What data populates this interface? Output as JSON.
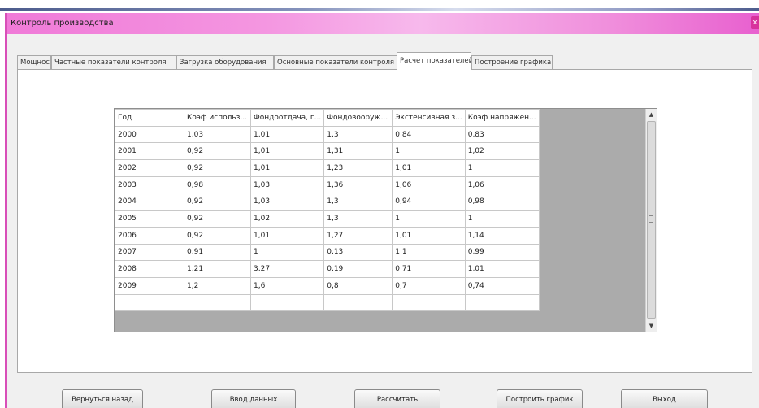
{
  "window": {
    "title": "Контроль производства",
    "close_label": "x"
  },
  "tabs": [
    {
      "label": "Мощность",
      "active": false
    },
    {
      "label": "Частные показатели контроля",
      "active": false
    },
    {
      "label": "Загрузка оборудования",
      "active": false
    },
    {
      "label": "Основные показатели контроля",
      "active": false
    },
    {
      "label": "Расчет показателей",
      "active": true
    },
    {
      "label": "Построение графика",
      "active": false
    }
  ],
  "grid": {
    "columns": [
      "Год",
      "Коэф использ...",
      "Фондоотдача, г...",
      "Фондовооруж...",
      "Экстенсивная з...",
      "Коэф напряжен..."
    ],
    "rows": [
      [
        "2000",
        "1,03",
        "1,01",
        "1,3",
        "0,84",
        "0,83"
      ],
      [
        "2001",
        "0,92",
        "1,01",
        "1,31",
        "1",
        "1,02"
      ],
      [
        "2002",
        "0,92",
        "1,01",
        "1,23",
        "1,01",
        "1"
      ],
      [
        "2003",
        "0,98",
        "1,03",
        "1,36",
        "1,06",
        "1,06"
      ],
      [
        "2004",
        "0,92",
        "1,03",
        "1,3",
        "0,94",
        "0,98"
      ],
      [
        "2005",
        "0,92",
        "1,02",
        "1,3",
        "1",
        "1"
      ],
      [
        "2006",
        "0,92",
        "1,01",
        "1,27",
        "1,01",
        "1,14"
      ],
      [
        "2007",
        "0,91",
        "1",
        "0,13",
        "1,1",
        "0,99"
      ],
      [
        "2008",
        "1,21",
        "3,27",
        "0,19",
        "0,71",
        "1,01"
      ],
      [
        "2009",
        "1,2",
        "1,6",
        "0,8",
        "0,7",
        "0,74"
      ],
      [
        "",
        "",
        "",
        "",
        "",
        ""
      ]
    ]
  },
  "buttons": {
    "back": "Вернуться назад",
    "input": "Ввод данных",
    "calculate": "Рассчитать",
    "plot": "Построить график",
    "exit": "Выход"
  }
}
